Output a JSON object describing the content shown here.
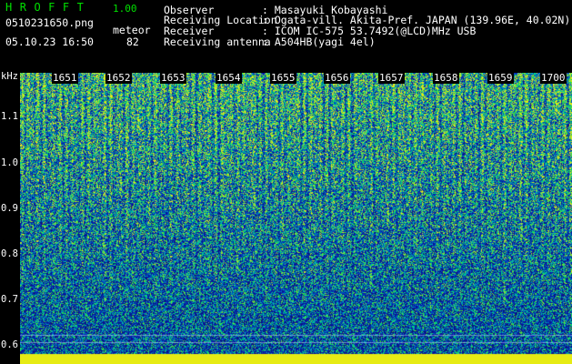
{
  "header": {
    "app_name": "HROFFT",
    "version": "1.00",
    "file_name": "0510231650.png",
    "mode_label": "meteor",
    "datetime": "05.10.23 16:50",
    "count": "82",
    "info": [
      {
        "label": "Observer",
        "value": ": Masayuki Kobayashi"
      },
      {
        "label": "Receiving Location",
        "value": ": Ogata-vill. Akita-Pref. JAPAN (139.96E, 40.02N)"
      },
      {
        "label": "Receiver",
        "value": ": ICOM IC-575 53.7492(@LCD)MHz USB"
      },
      {
        "label": "Receiving antenna",
        "value": ": A504HB(yagi 4el)"
      }
    ]
  },
  "y_axis": {
    "unit": "kHz",
    "ticks": [
      "1.1",
      "1.0",
      "0.9",
      "0.8",
      "0.7",
      "0.6"
    ]
  },
  "x_axis": {
    "ticks": [
      "1651",
      "1652",
      "1653",
      "1654",
      "1655",
      "1656",
      "1657",
      "1658",
      "1659",
      "1700"
    ]
  },
  "colors": {
    "accent_green": "#00e000",
    "spectrum_base": "#0a1a8c",
    "spectrum_peak": "#f0f000"
  }
}
